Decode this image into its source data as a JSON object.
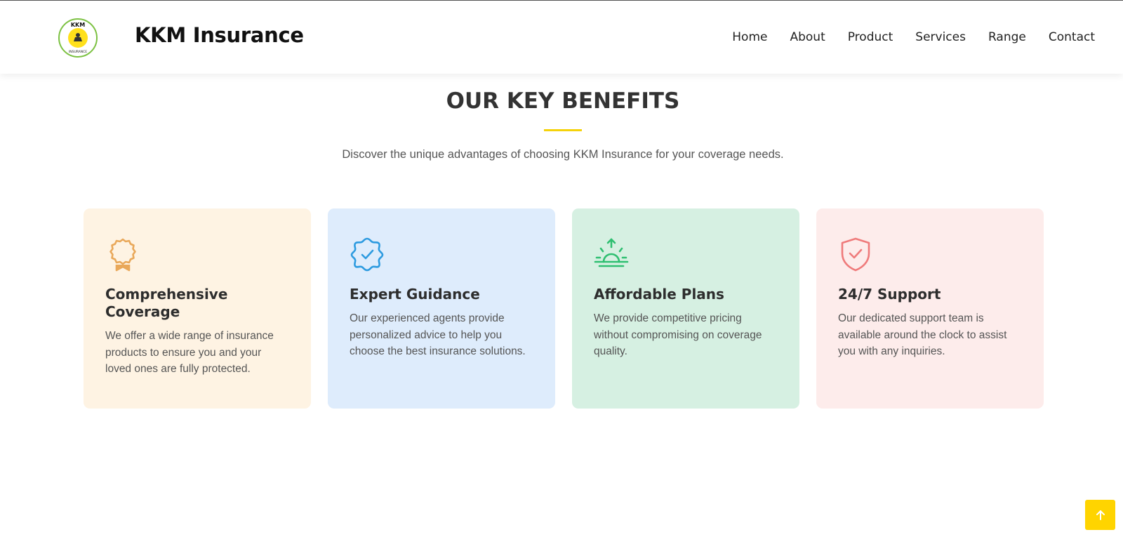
{
  "header": {
    "logo_text_top": "KKM",
    "logo_text_bottom": "INSURANCE",
    "brand": "KKM Insurance",
    "nav": [
      {
        "label": "Home"
      },
      {
        "label": "About"
      },
      {
        "label": "Product"
      },
      {
        "label": "Services"
      },
      {
        "label": "Range"
      },
      {
        "label": "Contact"
      }
    ]
  },
  "benefits": {
    "title": "OUR KEY BENEFITS",
    "subtitle": "Discover the unique advantages of choosing KKM Insurance for your coverage needs.",
    "accent_color": "#f5d20a",
    "cards": [
      {
        "icon": "award-icon",
        "icon_color": "#e9a85a",
        "bg_color": "#fef3e3",
        "title": "Comprehensive Coverage",
        "text": "We offer a wide range of insurance products to ensure you and your loved ones are fully protected."
      },
      {
        "icon": "badge-check-icon",
        "icon_color": "#2d9be0",
        "bg_color": "#deecfc",
        "title": "Expert Guidance",
        "text": "Our experienced agents provide personalized advice to help you choose the best insurance solutions."
      },
      {
        "icon": "sunrise-icon",
        "icon_color": "#2fbf71",
        "bg_color": "#d6f0e2",
        "title": "Affordable Plans",
        "text": "We provide competitive pricing without compromising on coverage quality."
      },
      {
        "icon": "shield-check-icon",
        "icon_color": "#ef7b7b",
        "bg_color": "#fdeceb",
        "title": "24/7 Support",
        "text": "Our dedicated support team is available around the clock to assist you with any inquiries."
      }
    ]
  },
  "back_to_top": {
    "icon": "arrow-up-icon",
    "color": "#ffd400"
  }
}
